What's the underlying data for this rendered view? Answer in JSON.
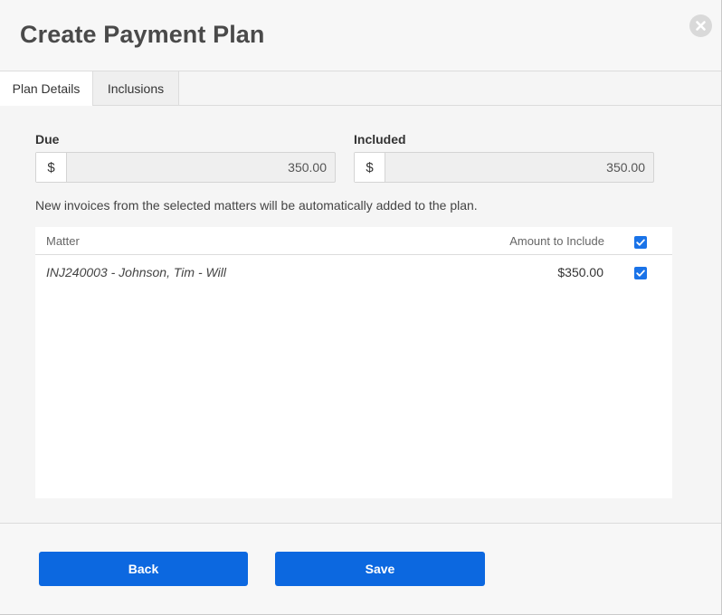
{
  "dialog": {
    "title": "Create Payment Plan"
  },
  "tabs": [
    {
      "label": "Plan Details",
      "active": true
    },
    {
      "label": "Inclusions",
      "active": false
    }
  ],
  "due": {
    "label": "Due",
    "currency": "$",
    "value": "350.00"
  },
  "included": {
    "label": "Included",
    "currency": "$",
    "value": "350.00"
  },
  "note": "New invoices from the selected matters will be automatically added to the plan.",
  "table": {
    "columns": {
      "matter": "Matter",
      "amount": "Amount to Include"
    },
    "select_all_checked": true,
    "rows": [
      {
        "matter": "INJ240003 - Johnson, Tim - Will",
        "amount": "$350.00",
        "checked": true
      }
    ]
  },
  "footer": {
    "back_label": "Back",
    "save_label": "Save"
  },
  "icons": {
    "close": "close-icon",
    "check": "checkmark-icon"
  },
  "colors": {
    "primary": "#0c68e0",
    "checkbox": "#1a73e8"
  }
}
